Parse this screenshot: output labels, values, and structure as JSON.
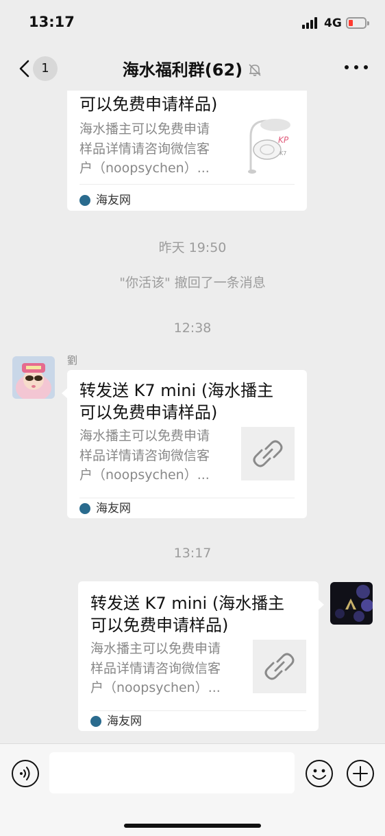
{
  "status_bar": {
    "time": "13:17",
    "network": "4G",
    "battery_level": 0.15,
    "battery_color": "#ff3b30"
  },
  "nav": {
    "unread_count": "1",
    "title": "海水福利群(62)",
    "muted_icon": "bell-off-icon",
    "more_icon": "ellipsis-icon"
  },
  "messages": {
    "partial_card": {
      "title_tail": "可以免费申请样品)",
      "desc": "海水播主可以免费申请\n样品详情请咨询微信客\n户（noopsychen）...",
      "source": "海友网"
    },
    "time_yesterday": "昨天 19:50",
    "recall_notice": "\"你活该\" 撤回了一条消息",
    "time_1238": "12:38",
    "incoming": {
      "sender": "劉",
      "title": "转发送 K7 mini (海水播主\n可以免费申请样品)",
      "desc": "海水播主可以免费申请\n样品详情请咨询微信客\n户（noopsychen）...",
      "source": "海友网"
    },
    "time_1317": "13:17",
    "outgoing": {
      "title": "转发送 K7 mini (海水播主\n可以免费申请样品)",
      "desc": "海水播主可以免费申请\n样品详情请咨询微信客\n户（noopsychen）...",
      "source": "海友网"
    }
  },
  "input_bar": {
    "placeholder": "",
    "voice_icon": "voice-icon",
    "emoji_icon": "emoji-icon",
    "plus_icon": "plus-icon"
  },
  "colors": {
    "background": "#ededed",
    "bubble": "#ffffff",
    "system_text": "#9c9c9c",
    "source_icon": "#2a6b8e"
  }
}
